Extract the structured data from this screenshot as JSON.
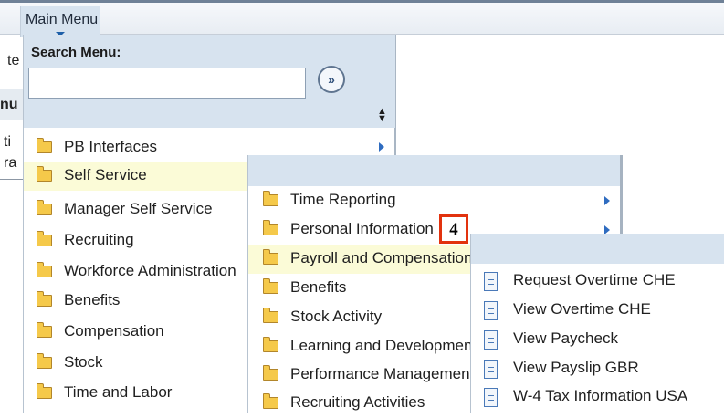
{
  "topbar": {
    "main_menu_label": "Main Menu"
  },
  "background_page": {
    "fragment_1": "te",
    "fragment_2": "nu",
    "fragment_3": "ti",
    "fragment_4": "ra"
  },
  "search": {
    "label": "Search Menu:",
    "value": "",
    "go_glyph": "»"
  },
  "menu1": {
    "items": [
      {
        "label": "PB Interfaces",
        "has_submenu": true
      },
      {
        "label": "Self Service",
        "highlighted": true
      },
      {
        "label": "Manager Self Service"
      },
      {
        "label": "Recruiting"
      },
      {
        "label": "Workforce Administration"
      },
      {
        "label": "Benefits"
      },
      {
        "label": "Compensation"
      },
      {
        "label": "Stock"
      },
      {
        "label": "Time and Labor"
      }
    ]
  },
  "menu2": {
    "items": [
      {
        "label": "Time Reporting",
        "has_submenu": true
      },
      {
        "label": "Personal Information",
        "has_submenu": true
      },
      {
        "label": "Payroll and Compensation",
        "highlighted": true
      },
      {
        "label": "Benefits"
      },
      {
        "label": "Stock Activity"
      },
      {
        "label": "Learning and Development"
      },
      {
        "label": "Performance Management"
      },
      {
        "label": "Recruiting Activities"
      }
    ]
  },
  "menu3": {
    "items": [
      {
        "label": "Request Overtime CHE"
      },
      {
        "label": "View Overtime CHE"
      },
      {
        "label": "View Paycheck"
      },
      {
        "label": "View Payslip GBR"
      },
      {
        "label": "W-4 Tax Information USA"
      }
    ]
  },
  "callout": {
    "step": "4"
  },
  "colors": {
    "menu_header": "#d7e3ef",
    "highlight": "#fbfbd7",
    "callout_border": "#e2320e",
    "arrow": "#2f6cc0",
    "folder": "#f5c94a"
  },
  "icons": {
    "folder": "folder-icon",
    "document": "document-icon",
    "submenu": "chevron-right-icon",
    "go": "double-chevron-right-icon",
    "sort": "sort-arrows-icon"
  }
}
